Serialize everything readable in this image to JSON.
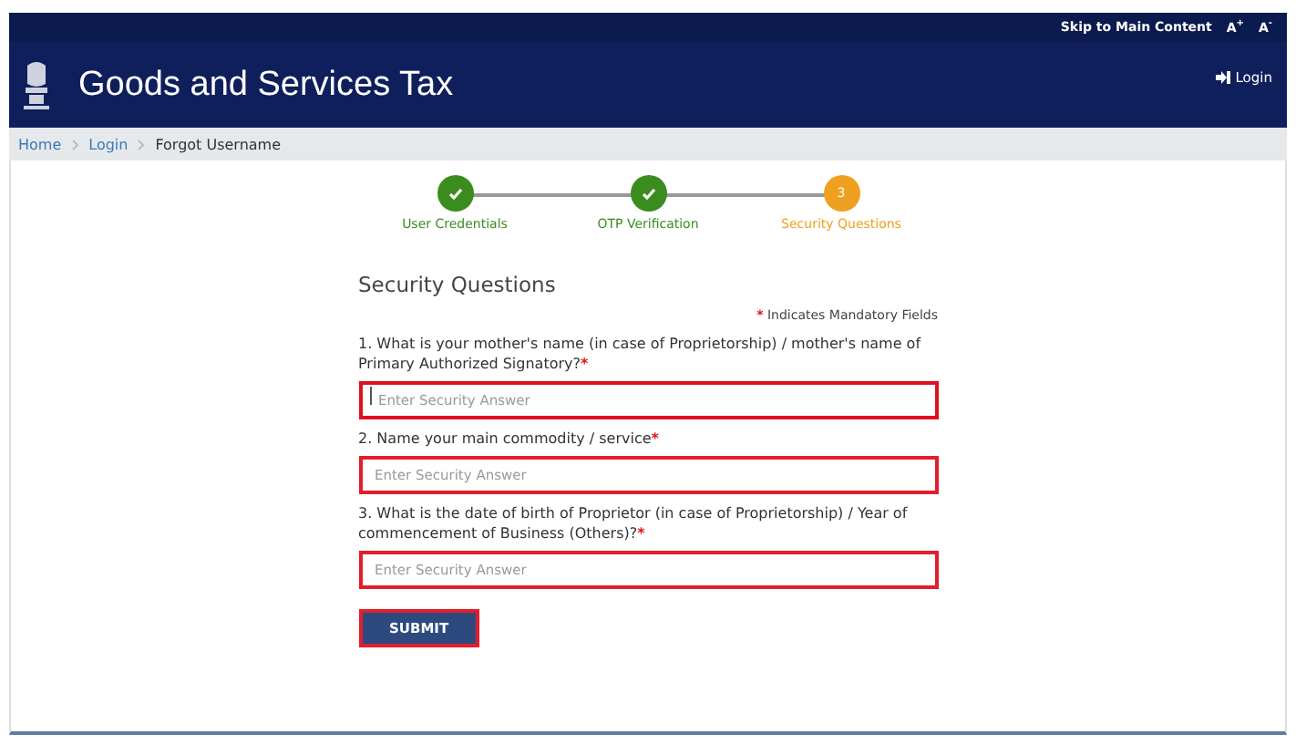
{
  "top_bar": {
    "links": [
      {
        "label": "Skip to Main Content"
      },
      {
        "label": "A",
        "sup": "+"
      },
      {
        "label": "A",
        "sup": "-"
      }
    ]
  },
  "header": {
    "title": "Goods and Services Tax",
    "login": "Login"
  },
  "breadcrumb": [
    {
      "label": "Home",
      "link": true
    },
    {
      "label": "Login",
      "link": true
    },
    {
      "label": "Forgot Username",
      "link": false
    }
  ],
  "steps": [
    {
      "label": "User Credentials",
      "completed": true
    },
    {
      "label": "OTP Verification",
      "completed": true
    },
    {
      "label": "Security Questions",
      "completed": false,
      "number": "3"
    }
  ],
  "form": {
    "title": "Security Questions",
    "legend": {
      "mark": "*",
      "text": "Indicates Mandatory Fields"
    },
    "questions": [
      {
        "label": "1. What is your mother's name (in case of Proprietorship) / mother's name of Primary Authorized Signatory?",
        "mark": "*",
        "placeholder": "Enter Security Answer",
        "focused": true
      },
      {
        "label": "2. Name your main commodity / service",
        "mark": "*",
        "placeholder": "Enter Security Answer",
        "focused": false
      },
      {
        "label": "3. What is the date of birth of Proprietor (in case of Proprietorship) / Year of commencement of Business (Others)?",
        "mark": "*",
        "placeholder": "Enter Security Answer",
        "focused": false
      }
    ],
    "submit": "SUBMIT"
  }
}
